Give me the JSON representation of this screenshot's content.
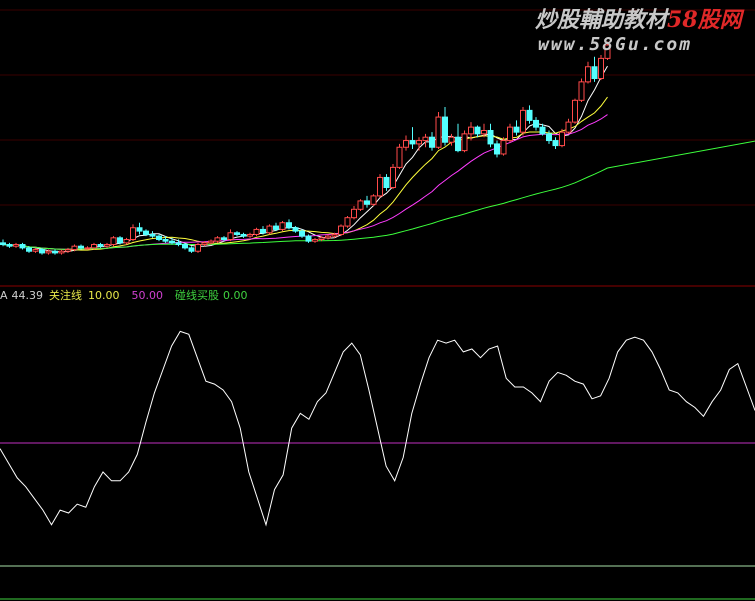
{
  "watermark": {
    "line1_a": "炒股輔助教材",
    "line1_b": "58股网",
    "line2": "www.58Gu.com",
    "color_a": "#c8c8c8",
    "color_b": "#e02828"
  },
  "indicator_header": {
    "value_prefix": "A",
    "value": "44.39",
    "focus_label": "关注线",
    "focus_value": "10.00",
    "mid_value": "50.00",
    "buy_label": "碰线买股",
    "buy_value": "0.00",
    "colors": {
      "value": "#cfcfcf",
      "focus": "#e8e84a",
      "mid": "#d040d0",
      "buy": "#3fd23f"
    }
  },
  "chart_data": [
    {
      "type": "candlestick",
      "title": "",
      "up_color": "#ff4a4a",
      "down_color": "#54ffff",
      "candles": [
        [
          21.5,
          21.7,
          21.3,
          21.4
        ],
        [
          21.4,
          21.5,
          21.2,
          21.3
        ],
        [
          21.3,
          21.5,
          21.2,
          21.4
        ],
        [
          21.4,
          21.5,
          21.1,
          21.2
        ],
        [
          21.2,
          21.3,
          20.9,
          21.0
        ],
        [
          21.0,
          21.2,
          20.9,
          21.1
        ],
        [
          21.1,
          21.2,
          20.8,
          20.9
        ],
        [
          20.9,
          21.1,
          20.8,
          21.0
        ],
        [
          21.0,
          21.1,
          20.8,
          20.9
        ],
        [
          20.9,
          21.1,
          20.8,
          21.0
        ],
        [
          21.0,
          21.2,
          20.9,
          21.1
        ],
        [
          21.1,
          21.4,
          21.0,
          21.3
        ],
        [
          21.3,
          21.4,
          21.1,
          21.2
        ],
        [
          21.2,
          21.3,
          21.1,
          21.2
        ],
        [
          21.2,
          21.5,
          21.1,
          21.4
        ],
        [
          21.4,
          21.5,
          21.2,
          21.3
        ],
        [
          21.3,
          21.5,
          21.2,
          21.4
        ],
        [
          21.4,
          21.9,
          21.3,
          21.8
        ],
        [
          21.8,
          21.9,
          21.4,
          21.5
        ],
        [
          21.5,
          21.8,
          21.4,
          21.7
        ],
        [
          21.7,
          22.6,
          21.6,
          22.4
        ],
        [
          22.4,
          22.7,
          22.0,
          22.2
        ],
        [
          22.2,
          22.3,
          21.9,
          22.0
        ],
        [
          22.0,
          22.2,
          21.8,
          21.9
        ],
        [
          21.9,
          22.0,
          21.6,
          21.7
        ],
        [
          21.7,
          21.9,
          21.5,
          21.6
        ],
        [
          21.6,
          21.8,
          21.4,
          21.5
        ],
        [
          21.5,
          21.7,
          21.3,
          21.4
        ],
        [
          21.4,
          21.5,
          21.1,
          21.2
        ],
        [
          21.2,
          21.3,
          20.9,
          21.0
        ],
        [
          21.0,
          21.5,
          20.9,
          21.4
        ],
        [
          21.4,
          21.6,
          21.3,
          21.5
        ],
        [
          21.5,
          21.7,
          21.4,
          21.6
        ],
        [
          21.6,
          21.9,
          21.5,
          21.8
        ],
        [
          21.8,
          21.9,
          21.6,
          21.7
        ],
        [
          21.7,
          22.3,
          21.6,
          22.1
        ],
        [
          22.1,
          22.2,
          21.9,
          22.0
        ],
        [
          22.0,
          22.1,
          21.8,
          21.9
        ],
        [
          21.9,
          22.1,
          21.8,
          22.0
        ],
        [
          22.0,
          22.4,
          21.9,
          22.3
        ],
        [
          22.3,
          22.5,
          22.0,
          22.1
        ],
        [
          22.1,
          22.6,
          22.0,
          22.5
        ],
        [
          22.5,
          22.7,
          22.2,
          22.3
        ],
        [
          22.3,
          22.8,
          22.2,
          22.7
        ],
        [
          22.7,
          22.9,
          22.3,
          22.4
        ],
        [
          22.4,
          22.5,
          22.1,
          22.2
        ],
        [
          22.2,
          22.3,
          21.8,
          21.9
        ],
        [
          21.9,
          22.0,
          21.5,
          21.6
        ],
        [
          21.6,
          21.8,
          21.5,
          21.7
        ],
        [
          21.7,
          21.9,
          21.6,
          21.8
        ],
        [
          21.8,
          22.0,
          21.7,
          21.9
        ],
        [
          21.9,
          22.1,
          21.8,
          22.0
        ],
        [
          22.0,
          22.6,
          21.9,
          22.5
        ],
        [
          22.5,
          23.1,
          22.4,
          23.0
        ],
        [
          23.0,
          23.7,
          22.9,
          23.5
        ],
        [
          23.5,
          24.1,
          23.4,
          24.0
        ],
        [
          24.0,
          24.3,
          23.6,
          23.8
        ],
        [
          23.8,
          24.4,
          23.7,
          24.3
        ],
        [
          24.3,
          25.6,
          24.2,
          25.4
        ],
        [
          25.4,
          25.6,
          24.6,
          24.8
        ],
        [
          24.8,
          26.2,
          24.7,
          26.0
        ],
        [
          26.0,
          27.4,
          25.9,
          27.2
        ],
        [
          27.2,
          27.9,
          27.0,
          27.6
        ],
        [
          27.6,
          28.4,
          27.1,
          27.4
        ],
        [
          27.4,
          27.8,
          27.0,
          27.6
        ],
        [
          27.6,
          28.0,
          27.2,
          27.8
        ],
        [
          27.8,
          28.1,
          27.0,
          27.2
        ],
        [
          27.2,
          29.3,
          27.1,
          29.0
        ],
        [
          29.0,
          29.6,
          27.3,
          27.5
        ],
        [
          27.5,
          28.0,
          27.3,
          27.8
        ],
        [
          27.8,
          28.6,
          26.9,
          27.0
        ],
        [
          27.0,
          28.2,
          26.9,
          28.0
        ],
        [
          28.0,
          28.7,
          27.6,
          28.4
        ],
        [
          28.4,
          28.5,
          27.8,
          28.0
        ],
        [
          28.0,
          28.6,
          27.8,
          28.2
        ],
        [
          28.2,
          28.6,
          27.2,
          27.4
        ],
        [
          27.4,
          27.6,
          26.6,
          26.8
        ],
        [
          26.8,
          27.8,
          26.7,
          27.6
        ],
        [
          27.6,
          28.6,
          27.5,
          28.4
        ],
        [
          28.4,
          28.8,
          27.9,
          28.1
        ],
        [
          28.1,
          29.6,
          27.9,
          29.4
        ],
        [
          29.4,
          29.7,
          28.6,
          28.8
        ],
        [
          28.8,
          29.0,
          28.2,
          28.4
        ],
        [
          28.4,
          28.6,
          27.9,
          28.0
        ],
        [
          28.0,
          28.2,
          27.4,
          27.6
        ],
        [
          27.6,
          27.8,
          27.1,
          27.3
        ],
        [
          27.3,
          28.3,
          27.2,
          28.1
        ],
        [
          28.1,
          28.9,
          28.0,
          28.7
        ],
        [
          28.7,
          30.1,
          28.6,
          30.0
        ],
        [
          30.0,
          31.3,
          29.9,
          31.1
        ],
        [
          31.1,
          32.3,
          31.0,
          32.0
        ],
        [
          32.0,
          32.6,
          31.1,
          31.3
        ],
        [
          31.3,
          32.7,
          31.2,
          32.5
        ],
        [
          32.5,
          33.5,
          32.4,
          33.3
        ]
      ],
      "ma_colors": [
        "#ffffff",
        "#ffff3c",
        "#ff3cff",
        "#3cff3c"
      ],
      "ylim": [
        20,
        33
      ]
    },
    {
      "type": "line",
      "title": "",
      "line_color": "#ffffff",
      "values": [
        51,
        46,
        41,
        38,
        34,
        30,
        25,
        30,
        29,
        32,
        31,
        38,
        43,
        40,
        40,
        43,
        49,
        60,
        70,
        78,
        86,
        91,
        90,
        82,
        74,
        73,
        71,
        67,
        58,
        43,
        34,
        25,
        37,
        42,
        58,
        63,
        61,
        67,
        70,
        77,
        84,
        87,
        83,
        71,
        58,
        45,
        40,
        48,
        63,
        73,
        82,
        88,
        87,
        88,
        84,
        85,
        82,
        85,
        86,
        75,
        72,
        72,
        70,
        67,
        74,
        77,
        76,
        74,
        73,
        68,
        69,
        75,
        84,
        88,
        89,
        88,
        84,
        78,
        71,
        70,
        67,
        65,
        62,
        67,
        71,
        78,
        80,
        72,
        64
      ],
      "ylim": [
        0,
        100
      ],
      "reference_lines": [
        {
          "value": 10,
          "color": "#a8e0a8"
        },
        {
          "value": 50,
          "color": "#c030c0"
        },
        {
          "value": 0,
          "color": "#3fd23f"
        }
      ]
    }
  ]
}
